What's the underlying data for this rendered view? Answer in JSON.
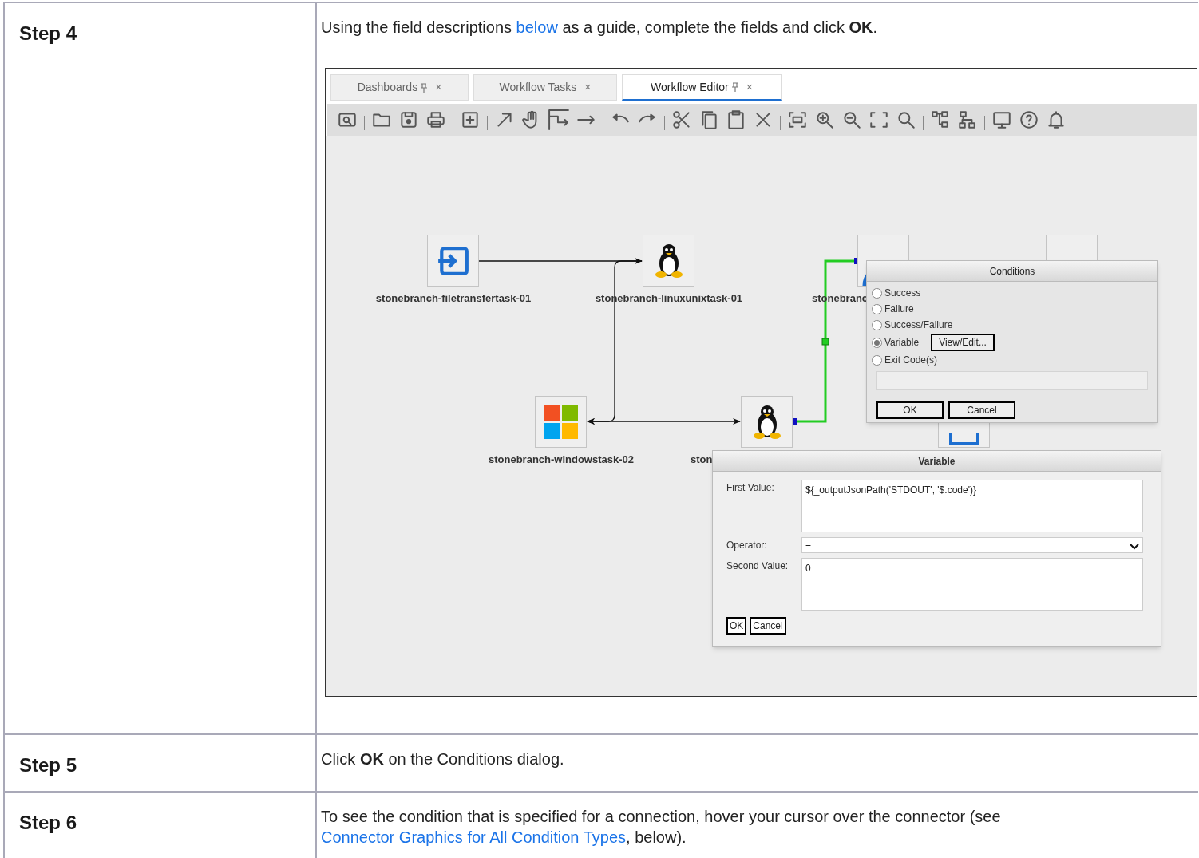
{
  "steps": [
    {
      "label": "Step 4",
      "instruction": [
        {
          "kind": "text",
          "text": "Using the field descriptions "
        },
        {
          "kind": "link",
          "text": "below"
        },
        {
          "kind": "text",
          "text": " as a guide, complete the fields and click **OK**."
        }
      ],
      "screenshot": {
        "tabs": [
          {
            "label": "Dashboards",
            "pinned": true,
            "selected": false
          },
          {
            "label": "Workflow Tasks",
            "pinned": false,
            "selected": false
          },
          {
            "label": "Workflow Editor",
            "pinned": true,
            "selected": true
          }
        ],
        "close_glyph": "×",
        "nodes": [
          {
            "kind": "filetransfer",
            "label": "stonebranch-filetransfertask-01"
          },
          {
            "kind": "linux",
            "label": "stonebranch-linuxunixtask-01"
          },
          {
            "kind": "agent",
            "label": "stonebranc"
          },
          {
            "kind": "zos"
          },
          {
            "kind": "windows",
            "label": "stonebranch-windowstask-02"
          },
          {
            "kind": "linux",
            "label": "ston"
          },
          {
            "kind": "tray"
          }
        ],
        "conditions_dialog": {
          "title": "Conditions",
          "options": [
            {
              "label": "Success",
              "selected": false
            },
            {
              "label": "Failure",
              "selected": false
            },
            {
              "label": "Success/Failure",
              "selected": false
            },
            {
              "label": "Variable",
              "selected": true,
              "button": "View/Edit..."
            },
            {
              "label": "Exit Code(s)",
              "selected": false
            }
          ],
          "buttons": [
            "OK",
            "Cancel"
          ]
        },
        "variable_dialog": {
          "title": "Variable",
          "first_value": {
            "label": "First Value:",
            "value": "${_outputJsonPath('STDOUT', '$.code')}"
          },
          "operator": {
            "label": "Operator:",
            "value": "="
          },
          "second_value": {
            "label": "Second Value:",
            "value": "0"
          },
          "buttons": [
            "OK",
            "Cancel"
          ]
        }
      }
    },
    {
      "label": "Step 5",
      "instruction": [
        {
          "kind": "text",
          "text": "Click **OK** on the Conditions dialog."
        }
      ]
    },
    {
      "label": "Step 6",
      "instruction": [
        {
          "kind": "text",
          "text": "To see the condition that is specified for a connection, hover your cursor over the connector (see "
        },
        {
          "kind": "link",
          "text": "Connector Graphics for All Condition Types"
        },
        {
          "kind": "text",
          "text": ", below)."
        }
      ]
    }
  ]
}
